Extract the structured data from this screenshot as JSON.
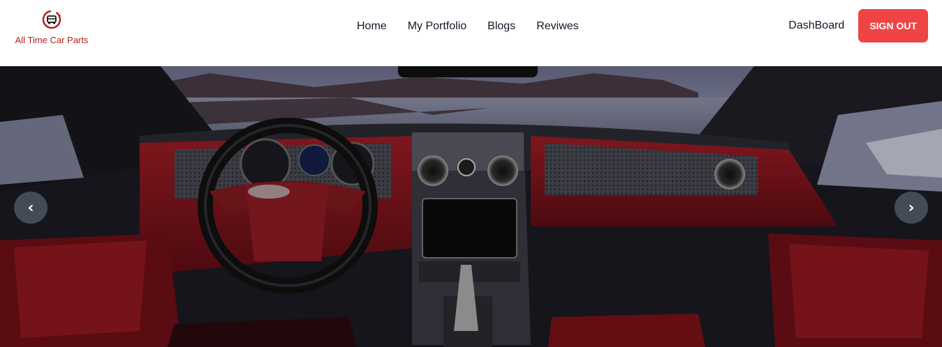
{
  "brand": {
    "name": "All Time Car Parts",
    "logo_icon": "car-gear-logo-icon",
    "color": "#b91c1c"
  },
  "nav": {
    "items": [
      {
        "label": "Home"
      },
      {
        "label": "My Portfolio"
      },
      {
        "label": "Blogs"
      },
      {
        "label": "Reviwes"
      }
    ],
    "dashboard_label": "DashBoard",
    "signout_label": "Sign out",
    "signout_color": "#ef4444"
  },
  "carousel": {
    "prev_glyph": "‹",
    "next_glyph": "›",
    "slide_description_icon": "car-interior-image"
  }
}
